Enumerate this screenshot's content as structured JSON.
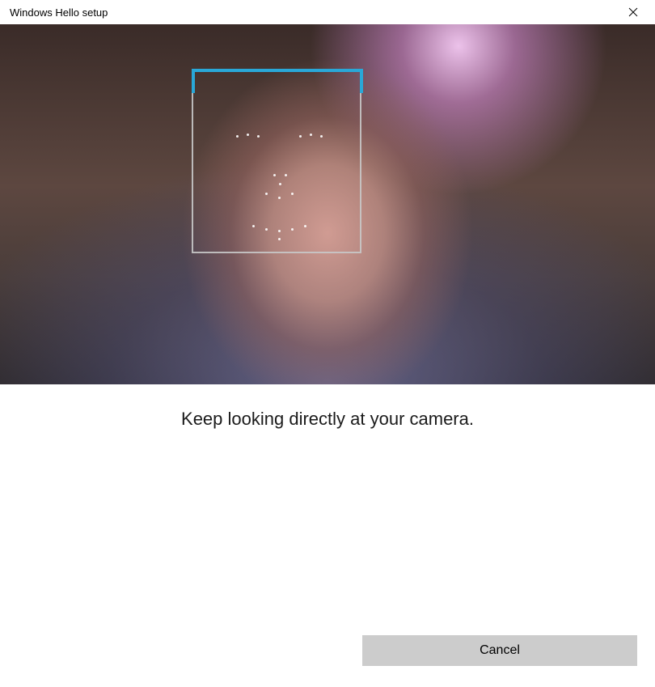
{
  "titlebar": {
    "title": "Windows Hello setup"
  },
  "camera": {
    "face_box_accent": "#29a8d8"
  },
  "instruction": {
    "text": "Keep looking directly at your camera."
  },
  "footer": {
    "cancel_label": "Cancel"
  }
}
